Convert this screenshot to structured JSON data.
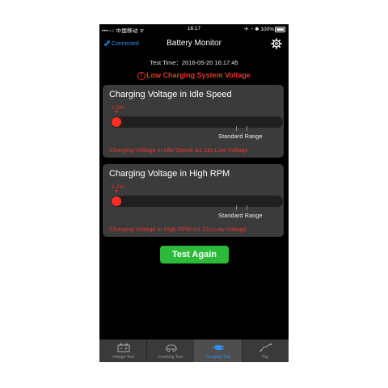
{
  "status_bar": {
    "carrier": "•••○○ 中国移动 ᯤ",
    "time": "16:17",
    "right": "✈ ◔ ✱ 100%"
  },
  "nav": {
    "connected": "Connected",
    "title": "Battery Monitor"
  },
  "test_time": "Test Time：2016-05-20 16:17:45",
  "alert": "Low Charging System Voltage",
  "cards": [
    {
      "title": "Charging Voltage in Idle Speed",
      "value_label": "1.19v",
      "range_label": "Standard Range",
      "message": "Charging Voltage in Idle Speed is1.19v,Low Voltage"
    },
    {
      "title": "Charging Voltage in High RPM",
      "value_label": "1.21v",
      "range_label": "Standard Range",
      "message": "Charging Voltage in High RPM is1.21v,Low Voltage"
    }
  ],
  "button": {
    "label": "Test Again"
  },
  "tabs": [
    {
      "label": "Voltage Test",
      "icon": "battery-icon"
    },
    {
      "label": "Cranking Test",
      "icon": "car-icon"
    },
    {
      "label": "Charging Test",
      "icon": "plug-icon",
      "active": true
    },
    {
      "label": "Trip",
      "icon": "trip-icon"
    }
  ],
  "colors": {
    "accent_blue": "#2e8ff0",
    "alert_red": "#e8362f",
    "button_green": "#2dba3a",
    "card_bg": "#3b3b3b"
  }
}
